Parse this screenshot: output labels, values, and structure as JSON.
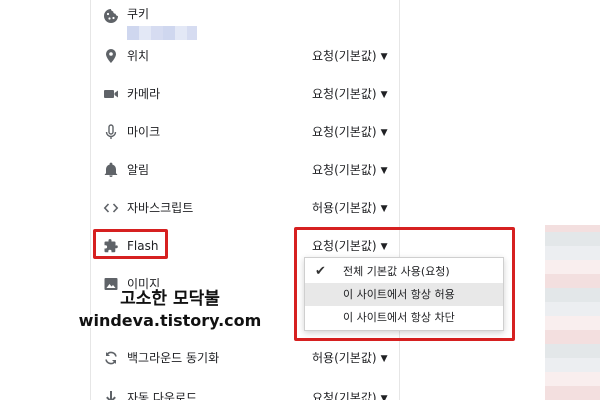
{
  "settings": {
    "rows": [
      {
        "id": "cookies",
        "icon": "cookie-icon",
        "label": "쿠키",
        "value": ""
      },
      {
        "id": "location",
        "icon": "location-pin-icon",
        "label": "위치",
        "value": "요청(기본값)"
      },
      {
        "id": "camera",
        "icon": "camera-icon",
        "label": "카메라",
        "value": "요청(기본값)"
      },
      {
        "id": "microphone",
        "icon": "microphone-icon",
        "label": "마이크",
        "value": "요청(기본값)"
      },
      {
        "id": "notifications",
        "icon": "bell-icon",
        "label": "알림",
        "value": "요청(기본값)"
      },
      {
        "id": "javascript",
        "icon": "code-icon",
        "label": "자바스크립트",
        "value": "허용(기본값)"
      },
      {
        "id": "flash",
        "icon": "puzzle-icon",
        "label": "Flash",
        "value": "요청(기본값)"
      },
      {
        "id": "images",
        "icon": "image-icon",
        "label": "이미지",
        "value": ""
      },
      {
        "id": "background-sync",
        "icon": "sync-icon",
        "label": "백그라운드 동기화",
        "value": "허용(기본값)"
      },
      {
        "id": "auto-download",
        "icon": "download-icon",
        "label": "자동 다운로드",
        "value": "요청(기본값)"
      }
    ]
  },
  "flash_dropdown": {
    "options": [
      {
        "label": "전체 기본값 사용(요청)",
        "checked": true
      },
      {
        "label": "이 사이트에서 항상 허용",
        "checked": false,
        "highlighted": true
      },
      {
        "label": "이 사이트에서 항상 차단",
        "checked": false
      }
    ]
  },
  "watermark": {
    "line1": "고소한 모닥불",
    "line2": "windeva.tistory.com"
  },
  "colors": {
    "highlight_border": "#d62020",
    "icon": "#5f6368",
    "menu_highlight": "#e8e8e8"
  }
}
